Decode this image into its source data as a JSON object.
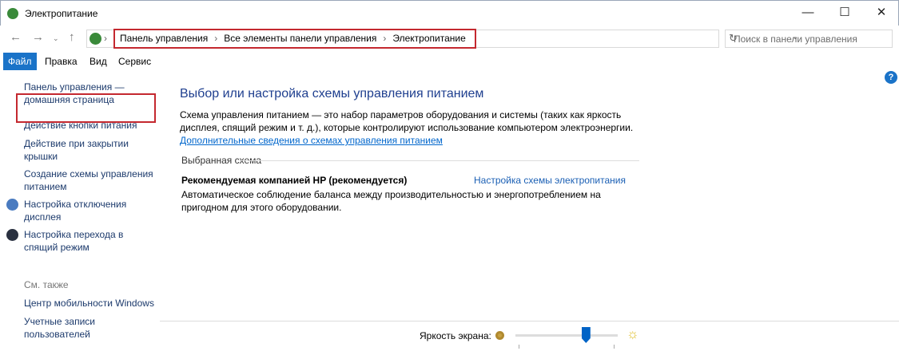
{
  "window": {
    "title": "Электропитание"
  },
  "address": {
    "crumbs": [
      "Панель управления",
      "Все элементы панели управления",
      "Электропитание"
    ],
    "search_placeholder": "Поиск в панели управления"
  },
  "menu": [
    "Файл",
    "Правка",
    "Вид",
    "Сервис"
  ],
  "sidebar": {
    "home": "Панель управления — домашняя страница",
    "links": [
      "Действие кнопки питания",
      "Действие при закрытии крышки",
      "Создание схемы управления питанием",
      "Настройка отключения дисплея",
      "Настройка перехода в спящий режим"
    ],
    "see_also": "См. также",
    "see_also_links": [
      "Центр мобильности Windows",
      "Учетные записи пользователей"
    ]
  },
  "main": {
    "heading": "Выбор или настройка схемы управления питанием",
    "description": "Схема управления питанием — это набор параметров оборудования и системы (таких как яркость дисплея, спящий режим и т. д.), которые контролируют использование компьютером электроэнергии.",
    "more_link": "Дополнительные сведения о схемах управления питанием",
    "group_label": "Выбранная схема",
    "plan_name": "Рекомендуемая компанией HP (рекомендуется)",
    "plan_link": "Настройка схемы электропитания",
    "plan_desc": "Автоматическое соблюдение баланса между производительностью и энергопотреблением на пригодном для этого оборудовании."
  },
  "brightness": {
    "label": "Яркость экрана:",
    "value_percent": 69
  },
  "help": "?"
}
